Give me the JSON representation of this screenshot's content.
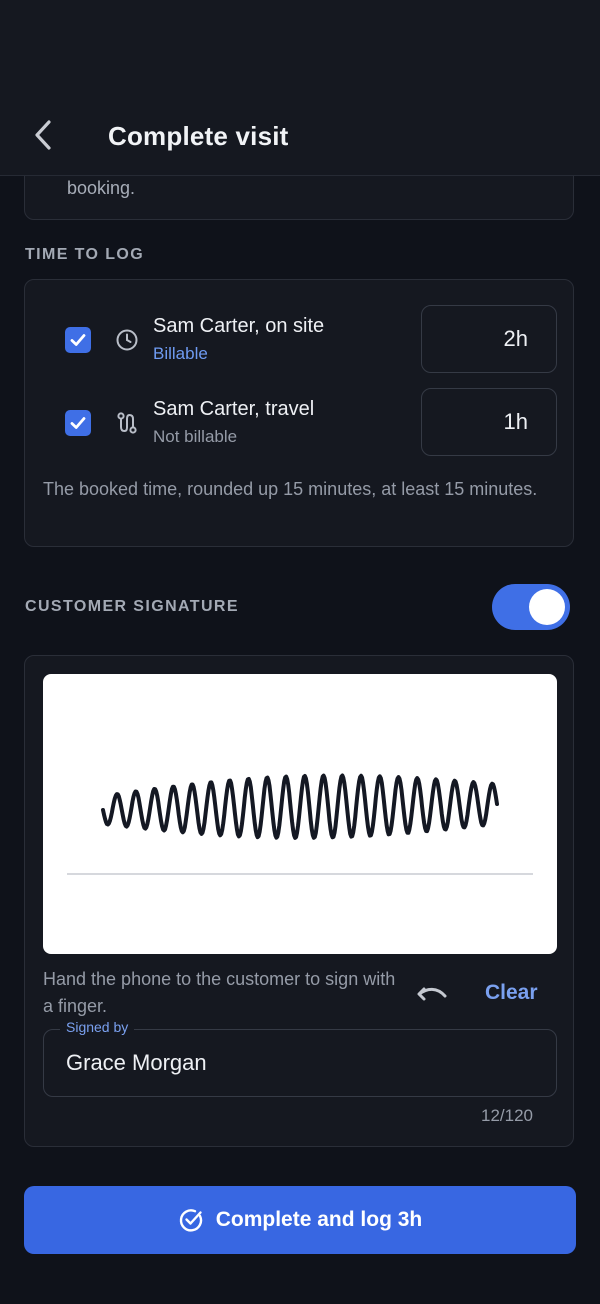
{
  "header": {
    "title": "Complete visit",
    "back_icon": "chevron-left-icon"
  },
  "previous_card": {
    "tail_text": "booking."
  },
  "time_to_log": {
    "label": "TIME TO LOG",
    "rows": [
      {
        "name": "Sam Carter, on site",
        "billing": "Billable",
        "hours": "2h",
        "checked": true,
        "icon": "clock-icon",
        "billing_color": "#6f9bf2"
      },
      {
        "name": "Sam Carter, travel",
        "billing": "Not billable",
        "hours": "1h",
        "checked": true,
        "icon": "route-icon",
        "billing_color": "#959ba7"
      }
    ],
    "note": "The booked time, rounded up 15 minutes, at least 15 minutes."
  },
  "customer_signature": {
    "label": "CUSTOMER SIGNATURE",
    "enabled": true,
    "hint": "Hand the phone to the customer to sign with a finger.",
    "undo_icon": "undo-icon",
    "clear_label": "Clear",
    "signed_by_label": "Signed by",
    "signed_by_value": "Grace Morgan",
    "counter": "12/120"
  },
  "actions": {
    "complete_label": "Complete and log 3h",
    "complete_icon": "check-circle-icon"
  },
  "colors": {
    "accent": "#3f6fe6",
    "background": "#0f121a",
    "card": "#151820"
  }
}
